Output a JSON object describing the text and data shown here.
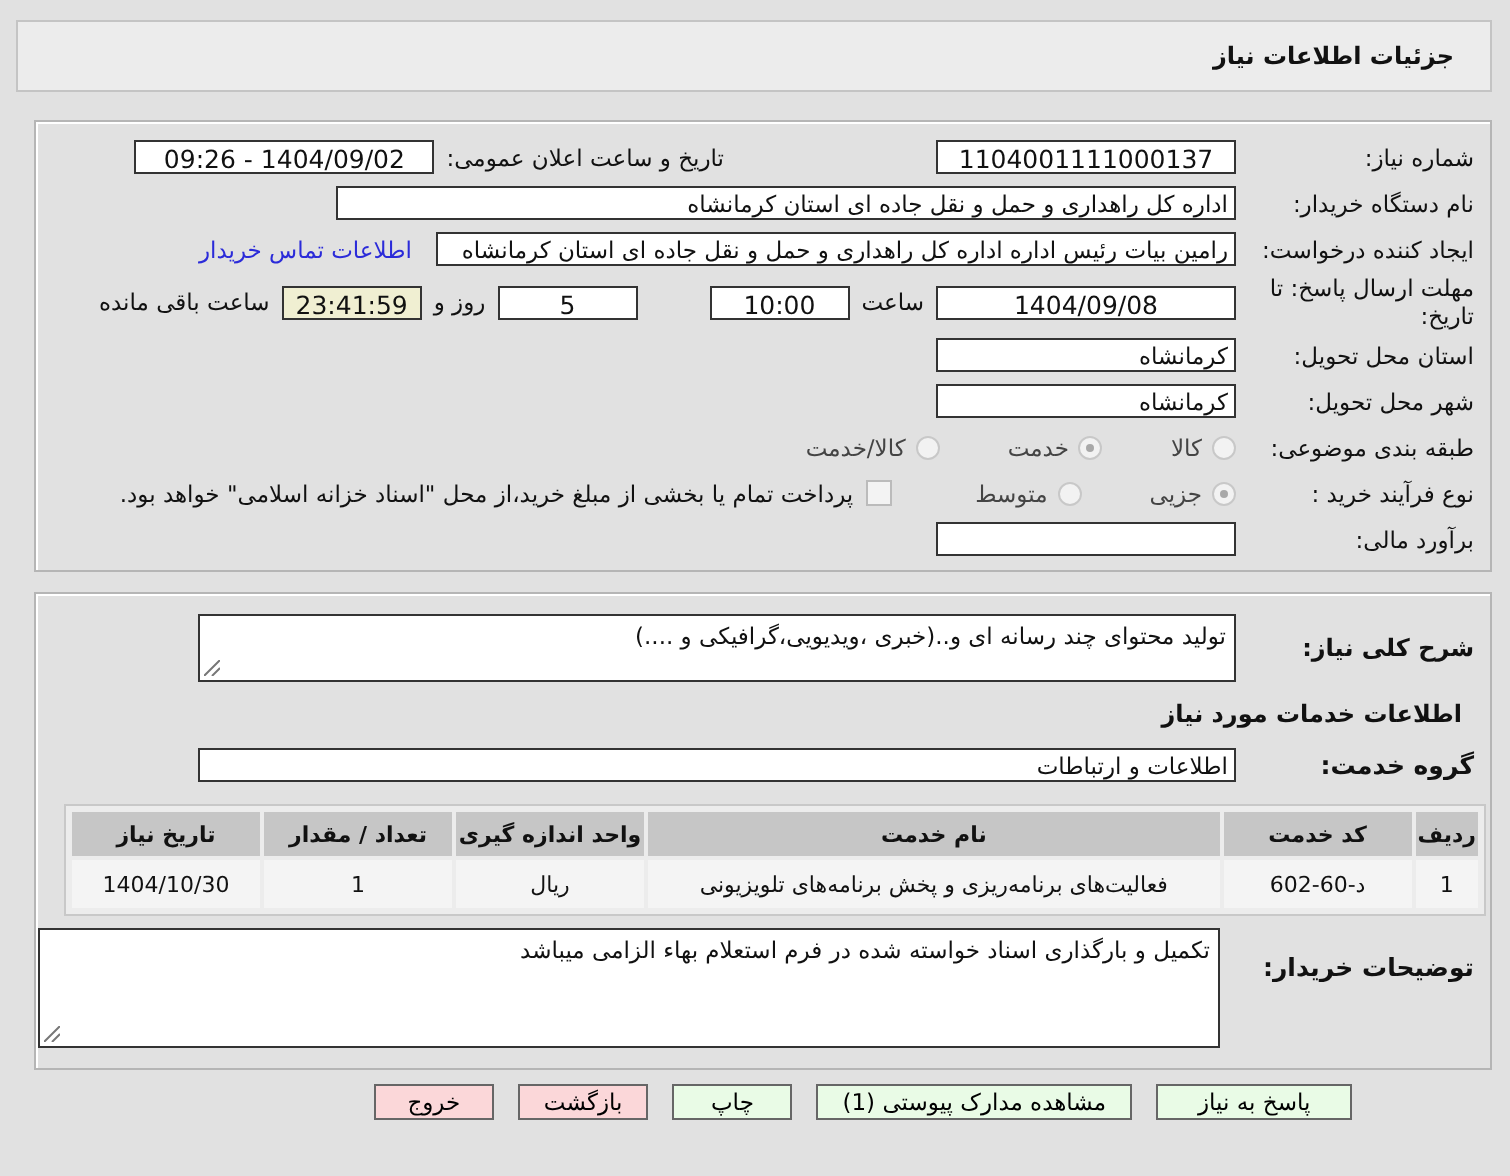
{
  "header": {
    "title": "جزئیات اطلاعات نیاز"
  },
  "details": {
    "need_number": {
      "label": "شماره نیاز:",
      "value": "1104001111000137"
    },
    "announce": {
      "label": "تاریخ و ساعت اعلان عمومی:",
      "value": "1404/09/02 - 09:26"
    },
    "buyer": {
      "label": "نام دستگاه خریدار:",
      "value": "اداره کل راهداری و حمل و نقل جاده ای استان کرمانشاه"
    },
    "creator": {
      "label": "ایجاد کننده درخواست:",
      "value": "رامین بیات رئیس اداره اداره کل راهداری و حمل و نقل جاده ای استان کرمانشاه",
      "link": "اطلاعات تماس خریدار"
    },
    "deadline": {
      "label": "مهلت ارسال پاسخ: تا تاریخ:",
      "date": "1404/09/08",
      "time_label": "ساعت",
      "time": "10:00",
      "days": "5",
      "days_label": "روز و",
      "remaining": "23:41:59",
      "remaining_label": "ساعت باقی مانده"
    },
    "province": {
      "label": "استان محل تحویل:",
      "value": "کرمانشاه"
    },
    "city": {
      "label": "شهر محل تحویل:",
      "value": "کرمانشاه"
    },
    "category": {
      "label": "طبقه بندی موضوعی:",
      "options": [
        {
          "label": "کالا",
          "selected": false
        },
        {
          "label": "خدمت",
          "selected": true
        },
        {
          "label": "کالا/خدمت",
          "selected": false
        }
      ]
    },
    "process": {
      "label": "نوع فرآیند خرید :",
      "options": [
        {
          "label": "جزیی",
          "selected": true
        },
        {
          "label": "متوسط",
          "selected": false
        }
      ],
      "payment": {
        "checked": false,
        "text": "پرداخت تمام یا بخشی از مبلغ خرید،از محل \"اسناد خزانه اسلامی\" خواهد بود."
      }
    },
    "estimate": {
      "label": "برآورد مالی:"
    }
  },
  "services": {
    "description": {
      "label": "شرح کلی نیاز:",
      "value": "تولید محتوای چند رسانه ای و..(خبری ،ویدیویی،گرافیکی و ....)"
    },
    "heading": "اطلاعات خدمات مورد نیاز",
    "group": {
      "label": "گروه خدمت:",
      "value": "اطلاعات و ارتباطات"
    },
    "table": {
      "columns": [
        "ردیف",
        "کد خدمت",
        "نام خدمت",
        "واحد اندازه گیری",
        "تعداد / مقدار",
        "تاریخ نیاز"
      ],
      "rows": [
        [
          "1",
          "د-60-602",
          "فعالیت‌های برنامه‌ریزی و پخش برنامه‌های تلویزیونی",
          "ریال",
          "1",
          "1404/10/30"
        ]
      ]
    },
    "notes": {
      "label": "توضیحات خریدار:",
      "value": "تکمیل و بارگذاری اسناد خواسته شده در فرم استعلام بهاء الزامی میباشد"
    }
  },
  "buttons": [
    {
      "label": "پاسخ به نیاز",
      "kind": "normal"
    },
    {
      "label": "مشاهده مدارک پیوستی (1)",
      "kind": "normal"
    },
    {
      "label": "چاپ",
      "kind": "normal"
    },
    {
      "label": "بازگشت",
      "kind": "danger"
    },
    {
      "label": "خروج",
      "kind": "danger"
    }
  ]
}
